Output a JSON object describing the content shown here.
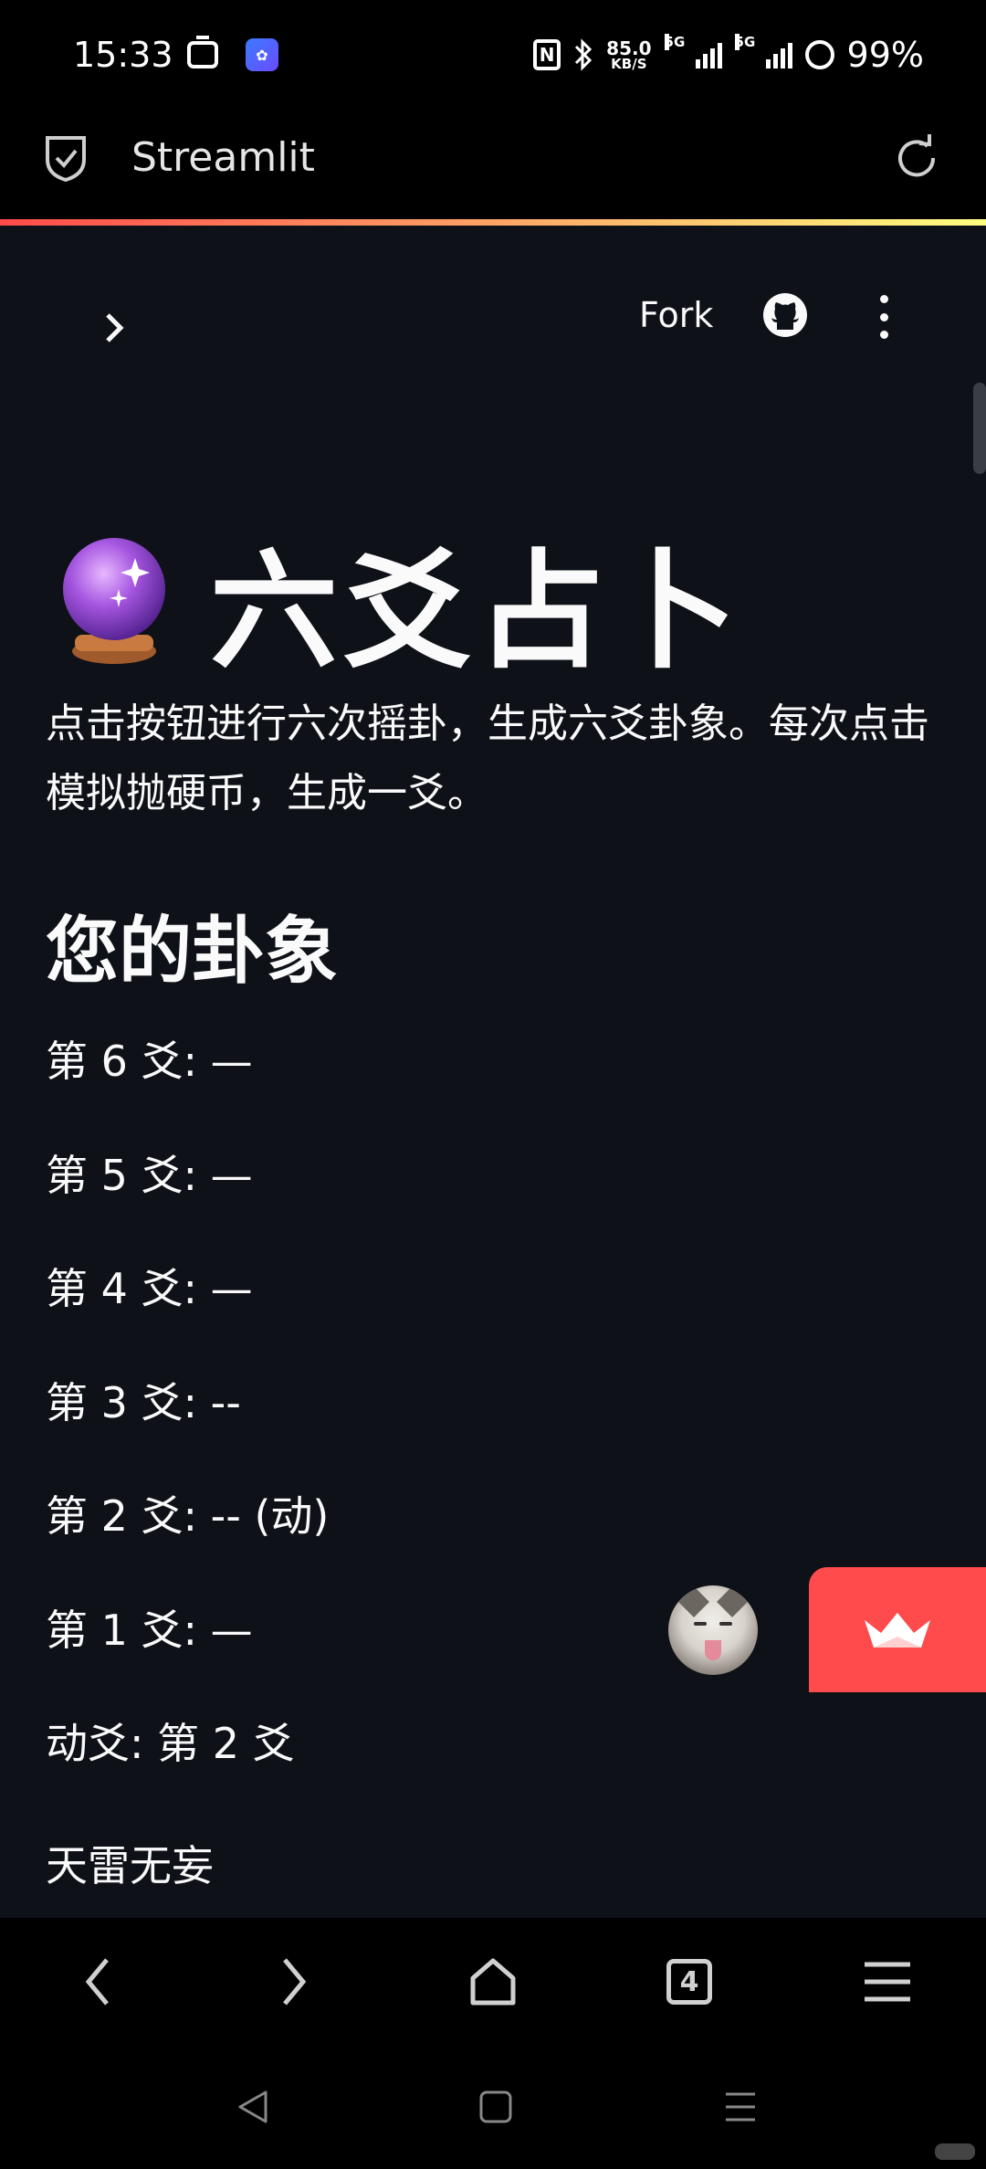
{
  "status_bar": {
    "time": "15:33",
    "speed_value": "85.0",
    "speed_unit": "KB/S",
    "network_1": "5G",
    "network_2": "5G",
    "battery": "99%"
  },
  "header": {
    "title": "Streamlit"
  },
  "toolbar": {
    "fork_label": "Fork"
  },
  "page": {
    "title": "六爻占卜",
    "intro": "点击按钮进行六次摇卦，生成六爻卦象。每次点击模拟抛硬币，生成一爻。",
    "section_heading": "您的卦象",
    "yao_lines": [
      "第 6 爻: —",
      "第 5 爻: —",
      "第 4 爻: —",
      "第 3 爻: --",
      "第 2 爻: -- (动)",
      "第 1 爻: —",
      "动爻: 第 2 爻"
    ],
    "hexagram_name": "天雷无妄"
  },
  "browser_bar": {
    "tab_count": "4"
  },
  "colors": {
    "app_background": "#0e1117",
    "accent_red": "#ff4b4b",
    "gradient_end": "#fffd80"
  }
}
